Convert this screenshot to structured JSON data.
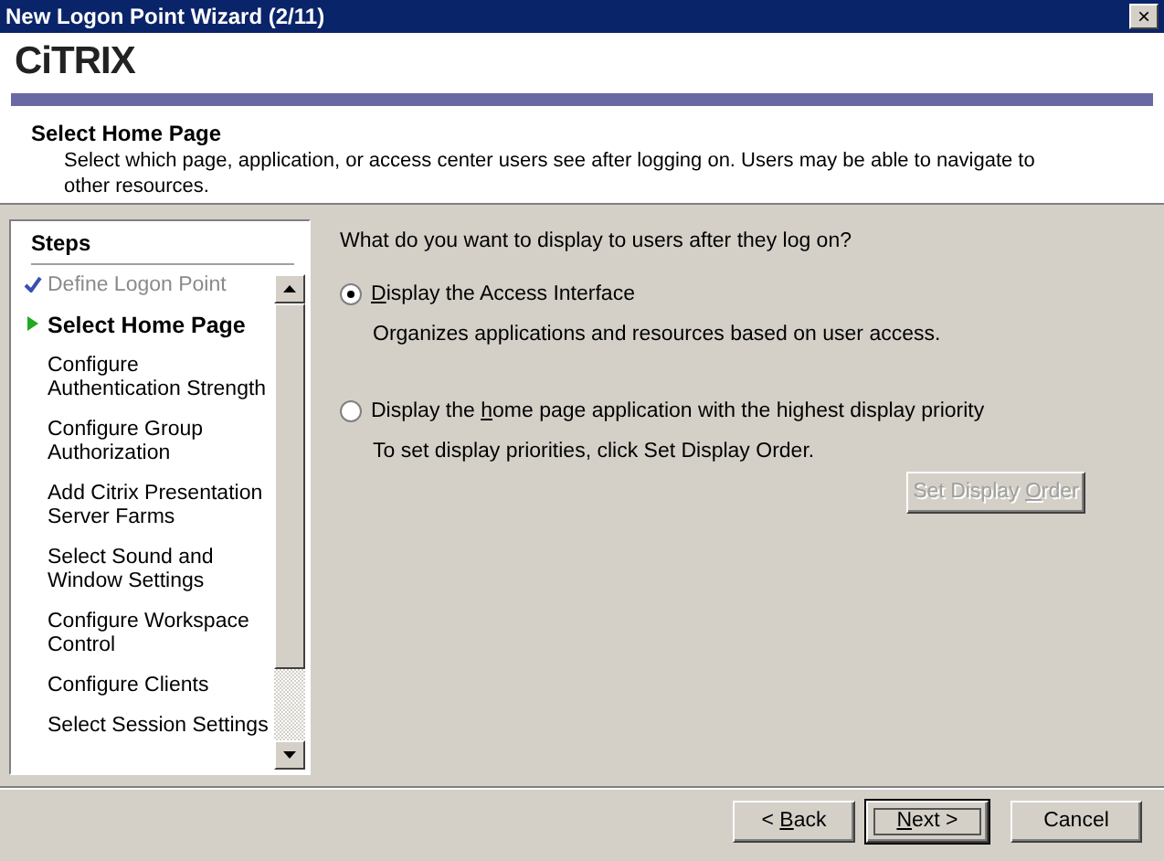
{
  "window": {
    "title": "New Logon Point Wizard (2/11)",
    "close": "×"
  },
  "header": {
    "logo": "CiTRIX",
    "title": "Select Home Page",
    "description": "Select which page, application, or access center users see after logging on. Users may be able to navigate to other resources."
  },
  "steps": {
    "title": "Steps",
    "items": [
      {
        "label": "Define Logon Point",
        "completed": true,
        "selected": false
      },
      {
        "label": "Select Home Page",
        "completed": false,
        "selected": true
      },
      {
        "label": "Configure Authentication Strength",
        "completed": false,
        "selected": false
      },
      {
        "label": "Configure Group Authorization",
        "completed": false,
        "selected": false
      },
      {
        "label": "Add Citrix Presentation Server Farms",
        "completed": false,
        "selected": false
      },
      {
        "label": "Select Sound and Window Settings",
        "completed": false,
        "selected": false
      },
      {
        "label": "Configure Workspace Control",
        "completed": false,
        "selected": false
      },
      {
        "label": "Configure Clients",
        "completed": false,
        "selected": false
      },
      {
        "label": "Select Session Settings",
        "completed": false,
        "selected": false
      }
    ]
  },
  "content": {
    "question": "What do you want to display to users after they log on?",
    "options": [
      {
        "label": {
          "key": "D",
          "after": "isplay the Access Interface"
        },
        "selected": true,
        "hint": "Organizes applications and resources based on user access."
      },
      {
        "label": {
          "before": "Display the ",
          "key": "h",
          "after": "ome page application with the highest display priority"
        },
        "selected": false,
        "hint": "To set display priorities, click Set Display Order."
      }
    ],
    "button": {
      "label": {
        "before": "Set Display ",
        "key": "O",
        "after": "rder"
      },
      "disabled": true
    }
  },
  "buttons": [
    {
      "label": {
        "before": "< ",
        "key": "B",
        "after": "ack"
      },
      "default": false
    },
    {
      "label": {
        "key": "N",
        "after": "ext >"
      },
      "default": true
    },
    {
      "label": {
        "before": "Cancel"
      },
      "default": false
    }
  ]
}
